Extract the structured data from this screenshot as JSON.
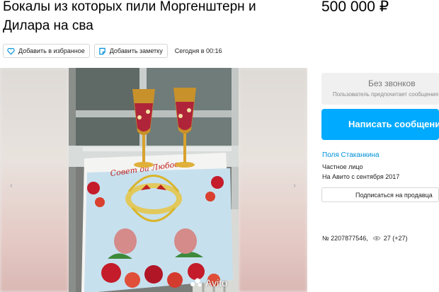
{
  "listing": {
    "title": "Бокалы из которых пили Моргенштерн и Дилара на сва",
    "price": "500 000 ₽",
    "favorite_label": "Добавить в избранное",
    "note_label": "Добавить заметку",
    "posted": "Сегодня в 00:16",
    "id_text": "№ 2207877546,",
    "views": "27 (+27)"
  },
  "gallery": {
    "watermark": "Avito",
    "towel_text": "Совет да Любовь"
  },
  "contact": {
    "no_calls_title": "Без звонков",
    "no_calls_sub": "Пользователь предпочитает сообщения",
    "message_button": "Написать сообщение"
  },
  "seller": {
    "name": "Поля Стаканкина",
    "type": "Частное лицо",
    "since": "На Авито с сентября 2017",
    "subscribe_label": "Подписаться на продавца"
  },
  "colors": {
    "accent": "#00aaff",
    "link": "#0091d9"
  }
}
